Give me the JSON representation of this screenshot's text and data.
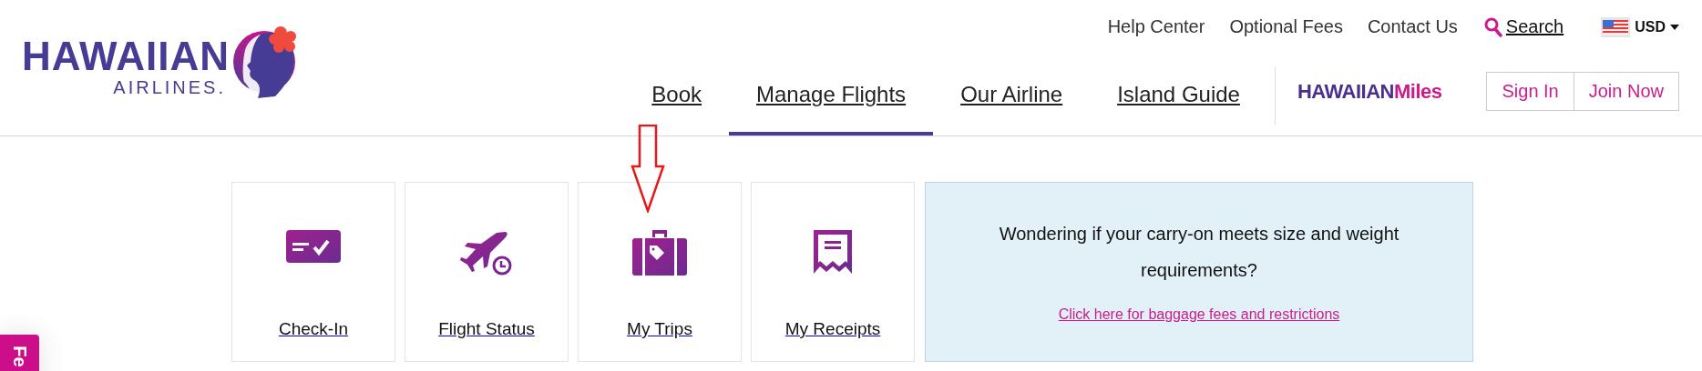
{
  "logo": {
    "name": "HAWAIIAN",
    "sub": "AIRLINES."
  },
  "top_links": [
    "Help Center",
    "Optional Fees",
    "Contact Us"
  ],
  "search": {
    "label": "Search"
  },
  "currency": {
    "label": "USD"
  },
  "nav": [
    {
      "label": "Book",
      "selected": false
    },
    {
      "label": "Manage Flights",
      "selected": true
    },
    {
      "label": "Our Airline",
      "selected": false
    },
    {
      "label": "Island Guide",
      "selected": false
    }
  ],
  "miles_logo": {
    "first": "HAWAIIAN",
    "second": "Miles"
  },
  "account_buttons": [
    "Sign In",
    "Join Now"
  ],
  "cards": [
    {
      "kind": "checkin",
      "label": "Check-In"
    },
    {
      "kind": "status",
      "label": "Flight Status"
    },
    {
      "kind": "trips",
      "label": "My Trips"
    },
    {
      "kind": "receipts",
      "label": "My Receipts"
    }
  ],
  "promo": {
    "text": "Wondering if your carry-on meets size and weight requirements?",
    "link": "Click here for baggage fees and restrictions"
  },
  "feedback_tab": {
    "label": "Fe"
  }
}
